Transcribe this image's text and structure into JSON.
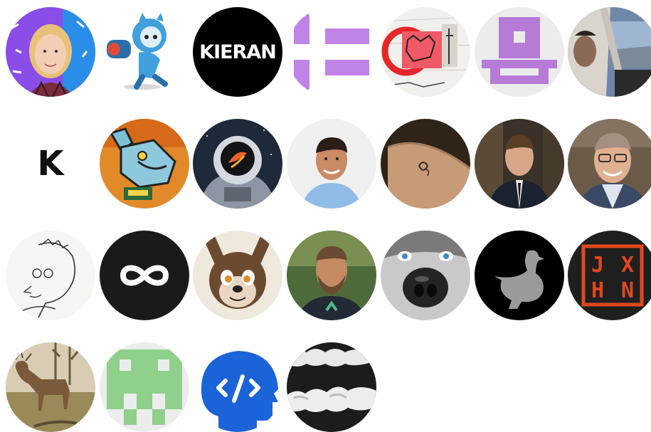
{
  "avatars": [
    {
      "name": "avatar-1",
      "kind": "photo-woman-blonde"
    },
    {
      "name": "avatar-2",
      "kind": "illustration-octocat-robot"
    },
    {
      "name": "avatar-3",
      "kind": "wordmark",
      "text": "KIERAN",
      "bg": "#000000",
      "fg": "#ffffff"
    },
    {
      "name": "avatar-4",
      "kind": "logo-purple-bars",
      "color": "#c084e8"
    },
    {
      "name": "avatar-5",
      "kind": "sketch-collage"
    },
    {
      "name": "avatar-6",
      "kind": "logo-purple-hat",
      "color": "#b57bd6"
    },
    {
      "name": "avatar-7",
      "kind": "photo-cockpit"
    },
    {
      "name": "avatar-8",
      "kind": "letter-logo",
      "text": "K",
      "bg": "#ffffff",
      "fg": "#111111"
    },
    {
      "name": "avatar-9",
      "kind": "pixel-art-mouse"
    },
    {
      "name": "avatar-10",
      "kind": "illustration-astronaut"
    },
    {
      "name": "avatar-11",
      "kind": "photo-man-smiling"
    },
    {
      "name": "avatar-12",
      "kind": "photo-wrist-tattoo"
    },
    {
      "name": "avatar-13",
      "kind": "photo-man-suit"
    },
    {
      "name": "avatar-14",
      "kind": "photo-man-glasses"
    },
    {
      "name": "avatar-15",
      "kind": "sketch-portrait"
    },
    {
      "name": "avatar-16",
      "kind": "infinity-logo",
      "bg": "#1a1a1a"
    },
    {
      "name": "avatar-17",
      "kind": "illustration-dog"
    },
    {
      "name": "avatar-18",
      "kind": "photo-man-beard"
    },
    {
      "name": "avatar-19",
      "kind": "photo-husky-nose"
    },
    {
      "name": "avatar-20",
      "kind": "goose-logo",
      "bg": "#000000"
    },
    {
      "name": "avatar-21",
      "kind": "monogram-logo",
      "text": "JXHN",
      "bg": "#1f1f1f",
      "fg": "#e0481e"
    },
    {
      "name": "avatar-22",
      "kind": "photo-deer"
    },
    {
      "name": "avatar-23",
      "kind": "pixel-identicon",
      "color": "#8fd08a"
    },
    {
      "name": "avatar-24",
      "kind": "code-head-logo",
      "color": "#1a63d8"
    },
    {
      "name": "avatar-25",
      "kind": "photo-clouds-bw"
    }
  ]
}
